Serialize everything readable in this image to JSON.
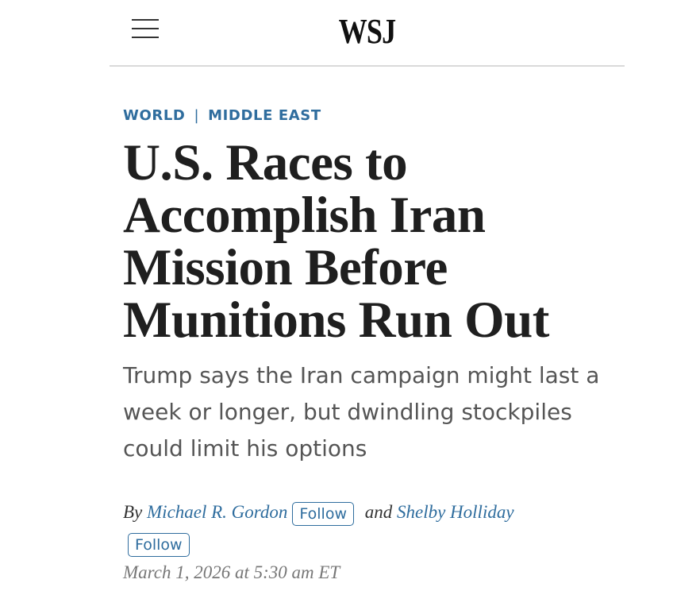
{
  "header": {
    "logo": "WSJ"
  },
  "article": {
    "section": "WORLD",
    "subsection": "MIDDLE EAST",
    "separator": "|",
    "headline": "U.S. Races to Accomplish Iran Mission Before Munitions Run Out",
    "dek": "Trump says the Iran campaign might last a week or longer, but dwindling stockpiles could limit his options",
    "byline": {
      "prefix": "By",
      "author1": "Michael R. Gordon",
      "follow1": "Follow",
      "conjunction": "and",
      "author2": "Shelby Holliday",
      "follow2": "Follow"
    },
    "date": "March 1, 2026 at 5:30 am ET"
  },
  "colors": {
    "accent": "#2f6d9e",
    "headline": "#1f1f1f",
    "dek": "#555555",
    "date": "#777777"
  }
}
